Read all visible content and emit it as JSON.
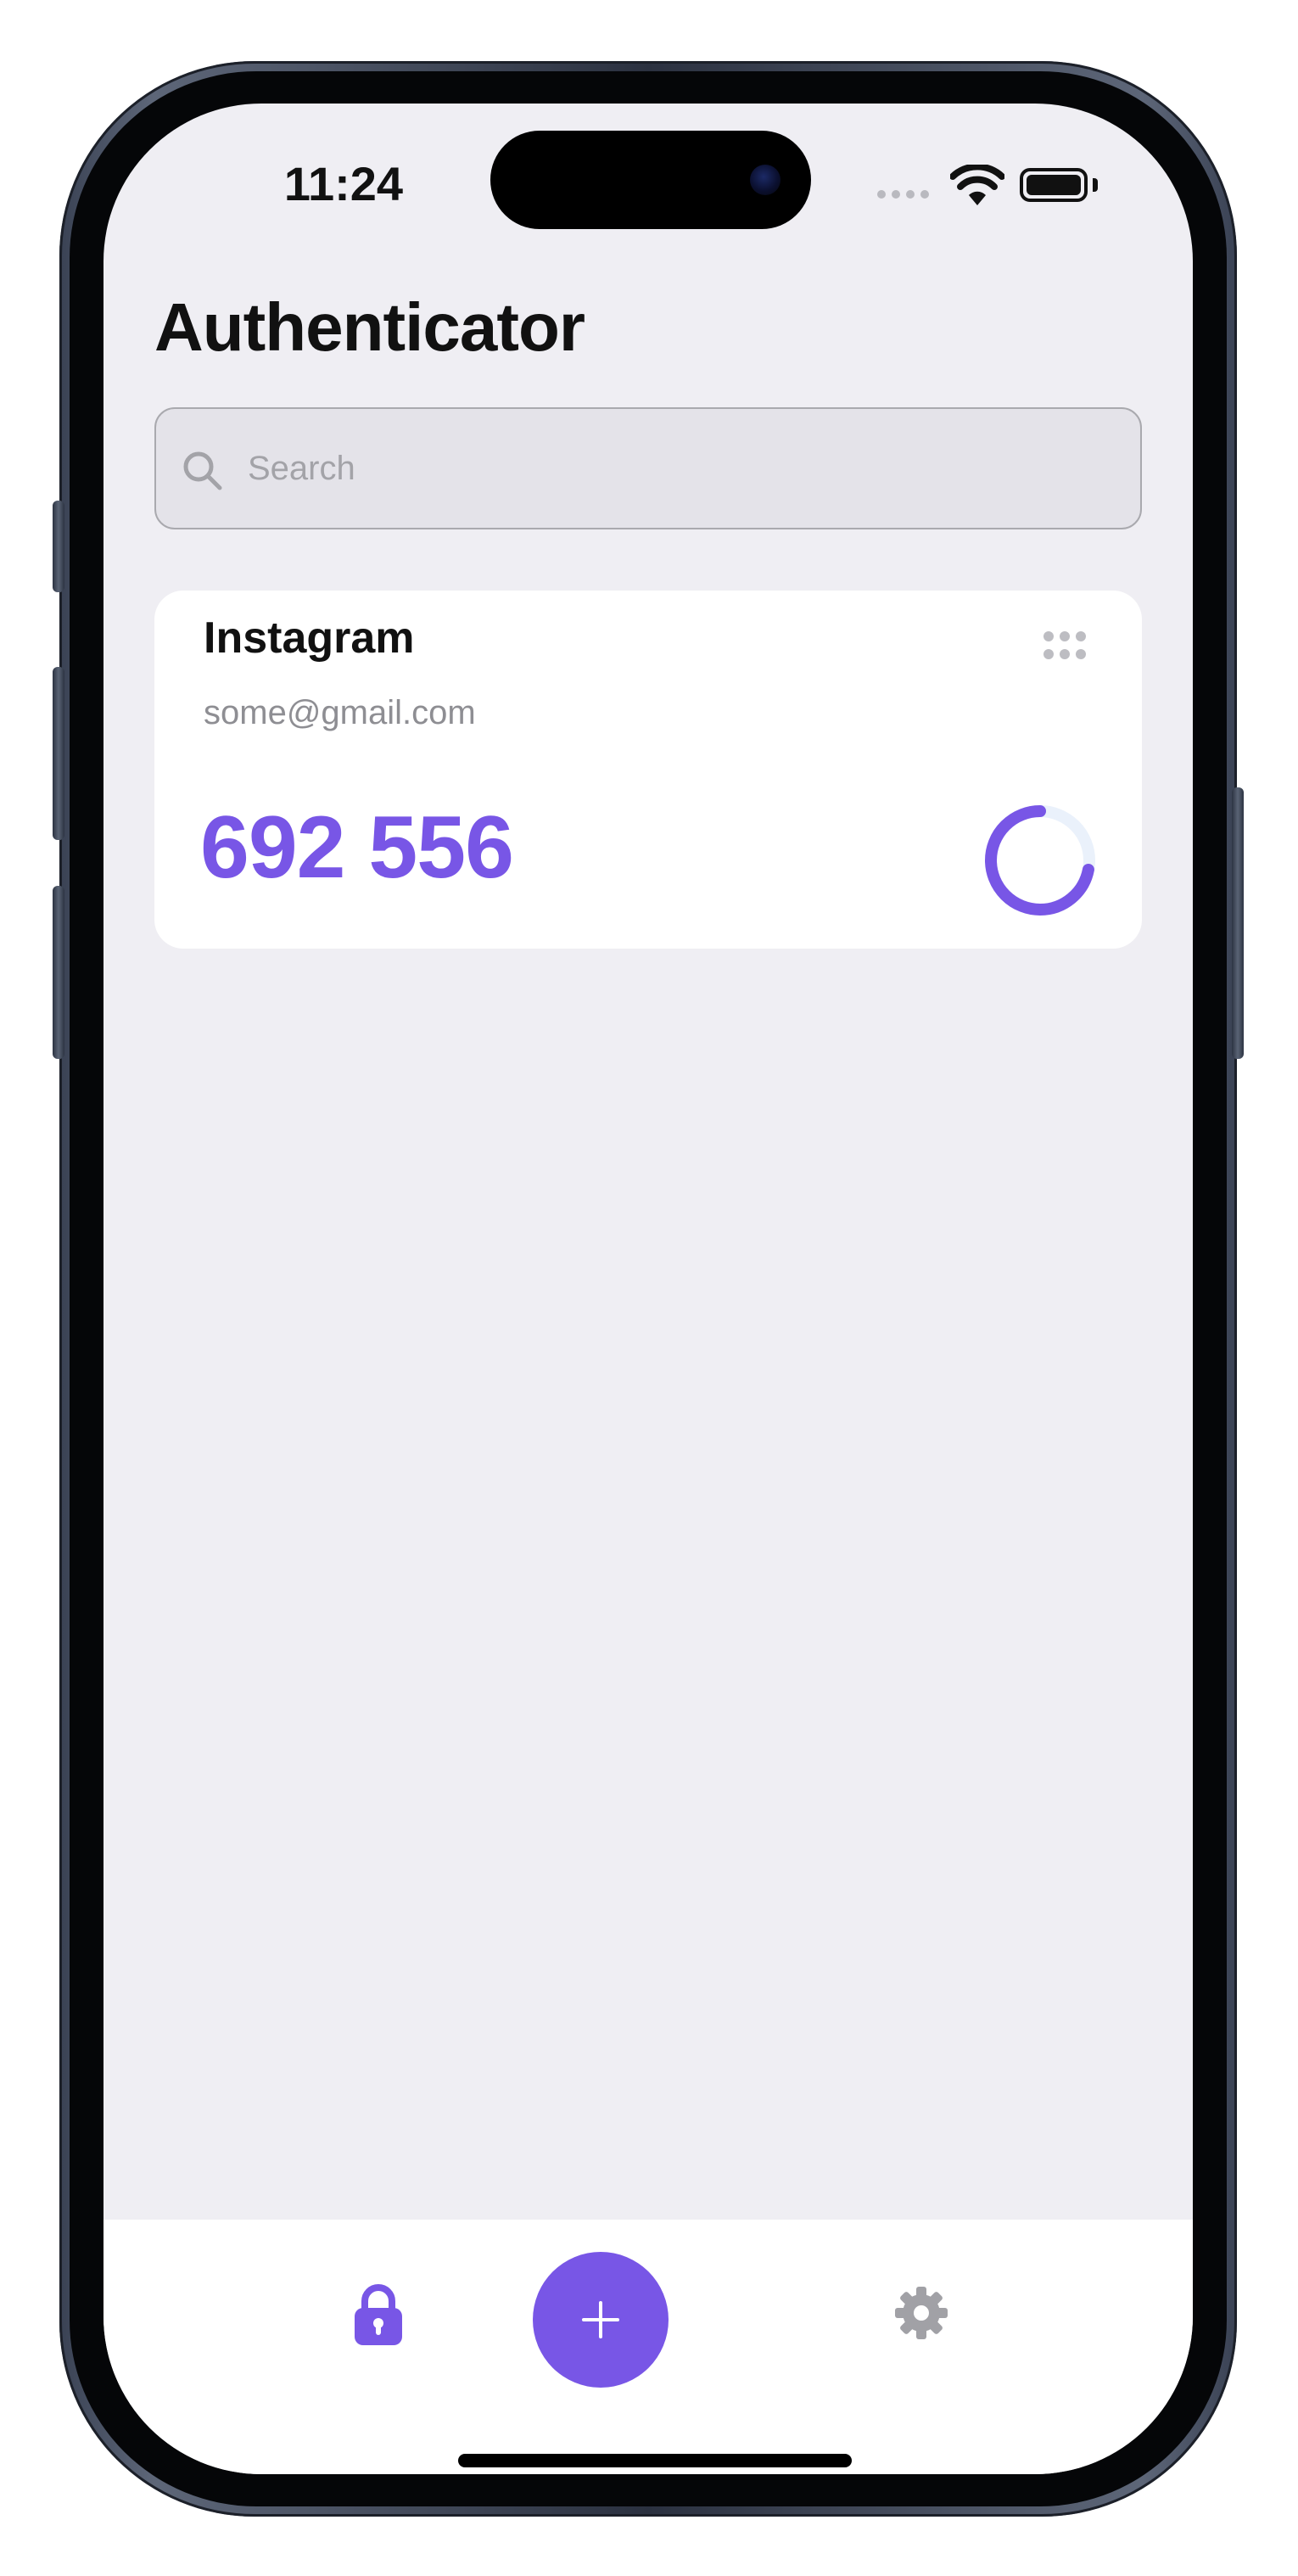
{
  "status_bar": {
    "time": "11:24"
  },
  "header": {
    "title": "Authenticator"
  },
  "search": {
    "placeholder": "Search",
    "value": ""
  },
  "accounts": [
    {
      "name": "Instagram",
      "email": "some@gmail.com",
      "code": "692 556",
      "timer_remaining_fraction": 0.72
    }
  ],
  "tab_bar": {
    "items": [
      {
        "icon": "lock-icon",
        "active": true
      },
      {
        "icon": "plus-icon",
        "role": "add"
      },
      {
        "icon": "gear-icon",
        "active": false
      }
    ]
  },
  "colors": {
    "accent": "#7856e6",
    "background": "#efeef3",
    "card": "#ffffff",
    "secondary_text": "#8e8e93",
    "inactive_icon": "#a1a1a6",
    "timer_track": "#eaf1fb"
  }
}
